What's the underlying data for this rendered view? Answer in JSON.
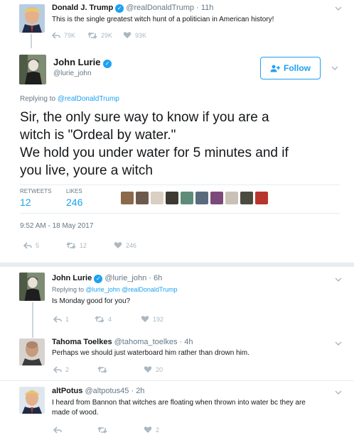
{
  "tweet1": {
    "name": "Donald J. Trump",
    "handle": "@realDonaldTrump",
    "time": "· 11h",
    "text": "This is the single greatest witch hunt of a politician in American history!",
    "replies": "79K",
    "retweets": "29K",
    "likes": "93K"
  },
  "main": {
    "name": "John Lurie",
    "handle": "@lurie_john",
    "follow_label": "Follow",
    "replying_prefix": "Replying to",
    "replying_to": "@realDonaldTrump",
    "text_line1": "Sir, the only sure way to know if you are a",
    "text_line2": "witch is \"Ordeal by water.\"",
    "text_line3": "We hold you under water for 5 minutes and if",
    "text_line4": "you live, youre a witch",
    "stats": {
      "retweets_label": "RETWEETS",
      "retweets_value": "12",
      "likes_label": "LIKES",
      "likes_value": "246"
    },
    "liker_colors": [
      "#8a6a4a",
      "#6e5a4c",
      "#d9cfc2",
      "#3d3a33",
      "#5e8c7a",
      "#5a6b7c",
      "#7b4a7a",
      "#c9c1b5",
      "#4a4a40",
      "#b8352f"
    ],
    "timestamp": "9:52 AM - 18 May 2017",
    "replies": "5",
    "retweets": "12",
    "likes": "246"
  },
  "reply1": {
    "name": "John Lurie",
    "handle": "@lurie_john",
    "time": "· 6h",
    "replying_prefix": "Replying to",
    "replying_to": "@lurie_john @realDonaldTrump",
    "text": "Is Monday good for you?",
    "replies": "1",
    "retweets": "4",
    "likes": "192"
  },
  "reply2": {
    "name": "Tahoma Toelkes",
    "handle": "@tahoma_toelkes",
    "time": "· 4h",
    "text": "Perhaps we should just waterboard him rather than drown him.",
    "replies": "2",
    "retweets": "",
    "likes": "20"
  },
  "reply3": {
    "name": "altPotus",
    "handle": "@altpotus45",
    "time": "· 2h",
    "text_line1": "I heard from Bannon that witches are floating when thrown into water bc they are",
    "text_line2": "made of wood.",
    "replies": "",
    "retweets": "",
    "likes": "2"
  },
  "colors": {
    "accent": "#1da1f2",
    "muted": "#657786",
    "action": "#aab8c2",
    "divider": "#e6ecf0"
  }
}
